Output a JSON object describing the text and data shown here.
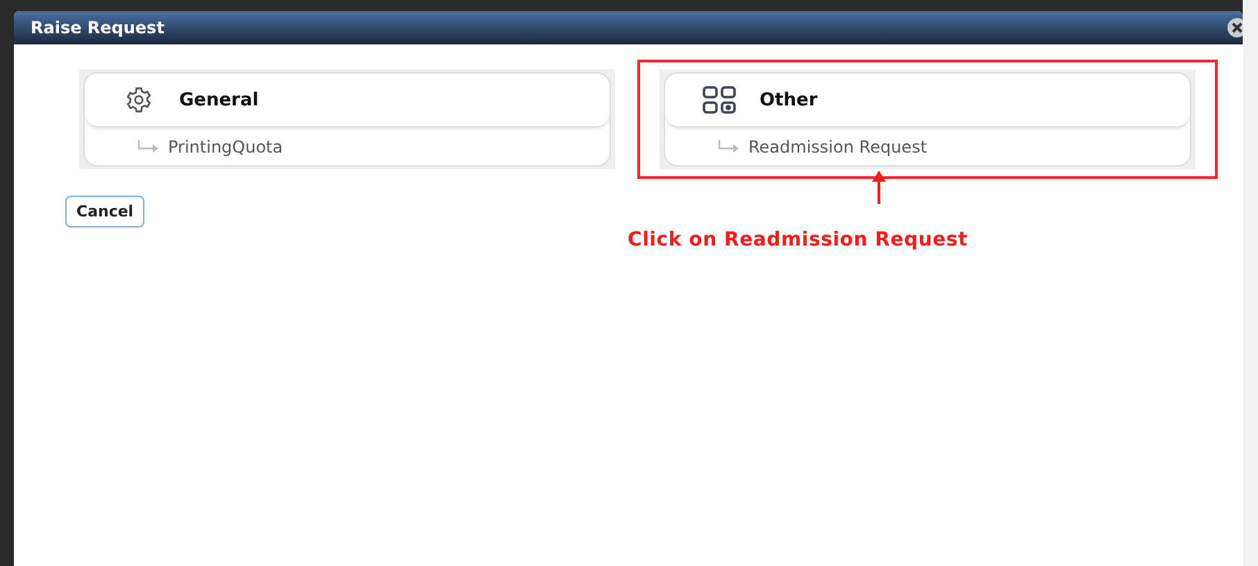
{
  "dialog": {
    "title": "Raise Request"
  },
  "categories": [
    {
      "title": "General",
      "kind": "gear",
      "highlighted": false,
      "items": [
        "PrintingQuota"
      ]
    },
    {
      "title": "Other",
      "kind": "grid",
      "highlighted": true,
      "items": [
        "Readmission Request"
      ]
    }
  ],
  "buttons": [
    "Cancel"
  ],
  "annotation": {
    "text": "Click on Readmission Request"
  }
}
